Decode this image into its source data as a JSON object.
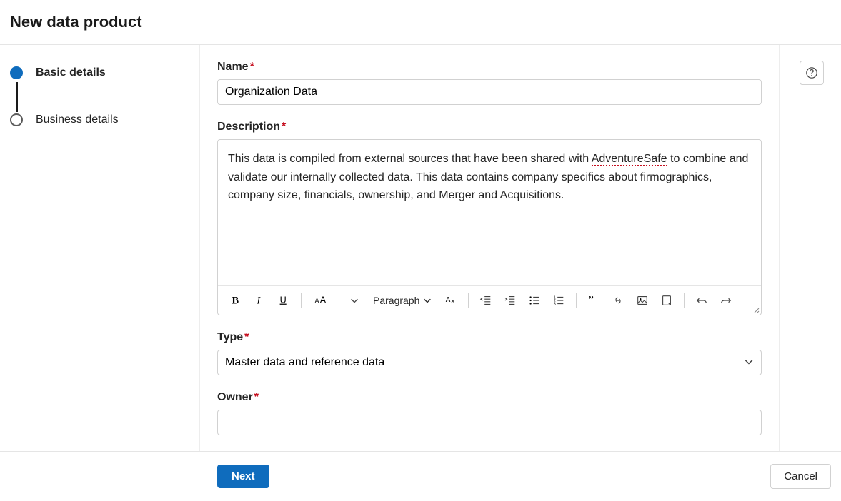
{
  "header": {
    "title": "New data product"
  },
  "steps": [
    {
      "label": "Basic details",
      "active": true
    },
    {
      "label": "Business details",
      "active": false
    }
  ],
  "form": {
    "name": {
      "label": "Name",
      "value": "Organization Data"
    },
    "description": {
      "label": "Description",
      "value_pre": "This data is compiled from external sources that have been shared with ",
      "spelling_word": "AdventureSafe",
      "value_post": " to combine and validate our internally collected data.  This data contains company specifics about firmographics, company size, financials, ownership, and Merger and Acquisitions.",
      "toolbar": {
        "paragraph_label": "Paragraph"
      }
    },
    "type": {
      "label": "Type",
      "selected": "Master data and reference data"
    },
    "owner": {
      "label": "Owner",
      "value": ""
    }
  },
  "footer": {
    "next": "Next",
    "cancel": "Cancel"
  },
  "icons": {
    "help": "help-icon"
  }
}
